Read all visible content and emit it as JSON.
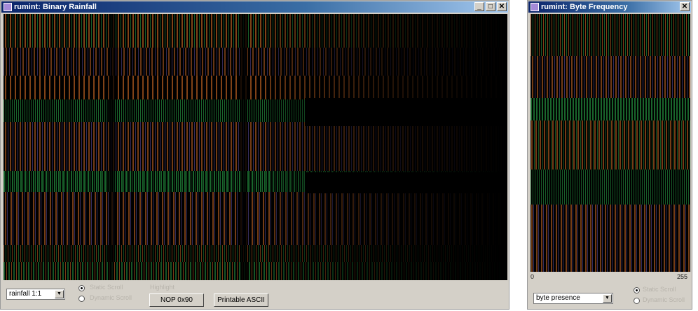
{
  "rainfall_window": {
    "title": "rumint: Binary Rainfall",
    "buttons": {
      "minimize": "_",
      "maximize": "□",
      "close": "✕"
    },
    "view_select": "rainfall 1:1",
    "scroll_options": [
      "Static Scroll",
      "Dynamic Scroll"
    ],
    "scroll_selected": "Static Scroll",
    "highlight_label": "Highlight",
    "highlight_buttons": [
      "NOP 0x90",
      "Printable ASCII"
    ]
  },
  "frequency_window": {
    "title": "rumint: Byte Frequency",
    "buttons": {
      "close": "✕"
    },
    "axis_min": "0",
    "axis_max": "255",
    "view_select": "byte presence",
    "scroll_options": [
      "Static Scroll",
      "Dynamic Scroll"
    ],
    "scroll_selected": "Static Scroll"
  },
  "colors": {
    "background": "#000000",
    "orange": "#e8782a",
    "green": "#2aa84a",
    "purple": "#6a5ab8",
    "title_active": "#0a246a"
  }
}
